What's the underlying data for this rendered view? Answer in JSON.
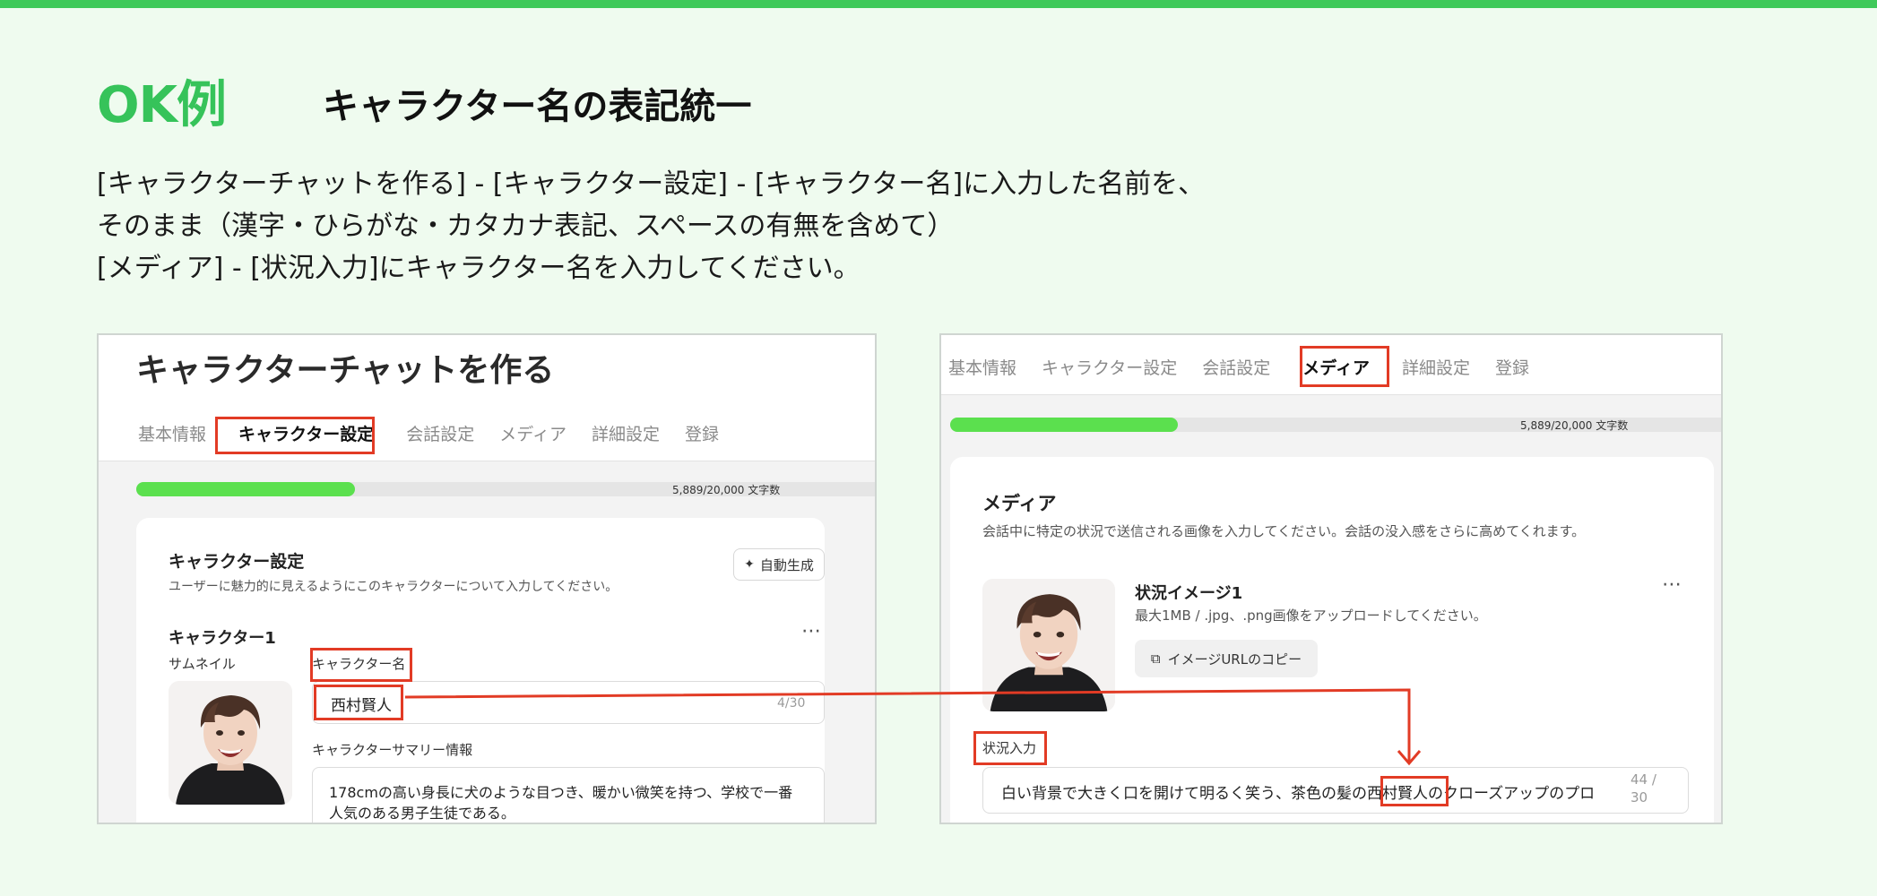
{
  "slide": {
    "ok_label": "OK例",
    "title": "キャラクター名の表記統一",
    "description": [
      "[キャラクターチャットを作る] - [キャラクター設定] - [キャラクター名]に入力した名前を、",
      "そのまま（漢字・ひらがな・カタカナ表記、スペースの有無を含めて）",
      "[メディア] - [状況入力]にキャラクター名を入力してください。"
    ],
    "accent_color": "#36c35a",
    "highlight_color": "#e23b25"
  },
  "left_panel": {
    "page_title": "キャラクターチャットを作る",
    "tabs": [
      "基本情報",
      "キャラクター設定",
      "会話設定",
      "メディア",
      "詳細設定",
      "登録"
    ],
    "active_tab": "キャラクター設定",
    "progress_text": "5,889/20,000 文字数",
    "progress_fraction": 0.2945,
    "section_title": "キャラクター設定",
    "section_desc": "ユーザーに魅力的に見えるようにこのキャラクターについて入力してください。",
    "auto_button": "自動生成",
    "character_heading": "キャラクター1",
    "thumbnail_label": "サムネイル",
    "name_label": "キャラクター名",
    "name_value": "西村賢人",
    "name_counter": "4/30",
    "summary_label": "キャラクターサマリー情報",
    "summary_line1": "178cmの高い身長に犬のような目つき、暖かい微笑を持つ、学校で一番",
    "summary_line2": "人気のある男子生徒である。"
  },
  "right_panel": {
    "tabs": [
      "基本情報",
      "キャラクター設定",
      "会話設定",
      "メディア",
      "詳細設定",
      "登録"
    ],
    "active_tab": "メディア",
    "progress_text": "5,889/20,000 文字数",
    "progress_fraction": 0.2945,
    "section_title": "メディア",
    "section_desc": "会話中に特定の状況で送信される画像を入力してください。会話の没入感をさらに高めてくれます。",
    "image_title": "状況イメージ1",
    "image_desc": "最大1MB / .jpg、.png画像をアップロードしてください。",
    "copy_button": "イメージURLのコピー",
    "situation_label": "状況入力",
    "situation_before": "白い背景で大きく口を開けて明るく笑う、茶色の髪の",
    "situation_name": "西村賢人",
    "situation_after": "のクローズアップのプロ",
    "situation_counter_top": "44 /",
    "situation_counter_bottom": "30"
  }
}
